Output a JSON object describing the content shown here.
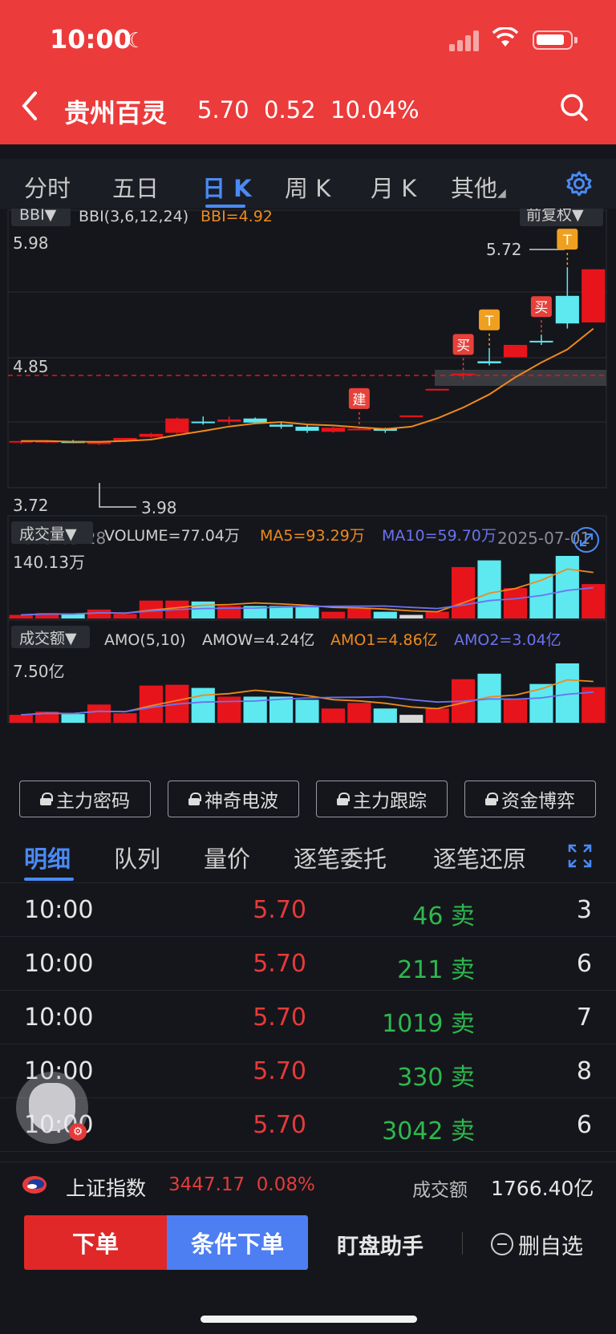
{
  "status": {
    "time": "10:00"
  },
  "header": {
    "name": "贵州百灵",
    "price": "5.70",
    "change": "0.52",
    "pct": "10.04%"
  },
  "ktabs": [
    "分时",
    "五日",
    "日 K",
    "周 K",
    "月 K",
    "其他"
  ],
  "chart": {
    "indicator_btn": "BBI▼",
    "indicator_label": "BBI(3,6,12,24)",
    "indicator_value": "BBI=4.92",
    "adjust_btn": "前复权▼",
    "y_top": "5.98",
    "y_mid": "4.85",
    "y_bottom": "3.72",
    "low_mark": "3.98",
    "high_mark": "5.72",
    "date_start": "2025-05-28",
    "date_end": "2025-07-01",
    "signals": [
      "建",
      "买",
      "T",
      "买",
      "T"
    ],
    "vol_btn": "成交量▼",
    "vol_label": "VOLUME=77.04万",
    "vol_ma5": "MA5=93.29万",
    "vol_ma10": "MA10=59.70万",
    "vol_max": "140.13万",
    "amt_btn": "成交额▼",
    "amt_label": "AMO(5,10)",
    "amt_amow": "AMOW=4.24亿",
    "amt_amo1": "AMO1=4.86亿",
    "amt_amo2": "AMO2=3.04亿",
    "amt_max": "7.50亿",
    "colors": {
      "up": "#e8141c",
      "down": "#5ee8f0",
      "ma_orange": "#ee8a1c",
      "ma_blue": "#6b72f0"
    }
  },
  "chart_data": {
    "type": "candlestick",
    "dates": [
      "2025-05-28",
      "2025-07-01"
    ],
    "ylim": [
      3.72,
      5.98
    ],
    "candles": [
      {
        "o": 4.01,
        "h": 4.02,
        "l": 3.99,
        "c": 4.02
      },
      {
        "o": 4.01,
        "h": 4.03,
        "l": 4.0,
        "c": 4.02
      },
      {
        "o": 4.02,
        "h": 4.03,
        "l": 4.0,
        "c": 4.0
      },
      {
        "o": 3.99,
        "h": 4.02,
        "l": 3.98,
        "c": 4.01
      },
      {
        "o": 4.02,
        "h": 4.05,
        "l": 4.01,
        "c": 4.05
      },
      {
        "o": 4.06,
        "h": 4.1,
        "l": 4.05,
        "c": 4.09
      },
      {
        "o": 4.1,
        "h": 4.25,
        "l": 4.09,
        "c": 4.24
      },
      {
        "o": 4.21,
        "h": 4.26,
        "l": 4.18,
        "c": 4.2
      },
      {
        "o": 4.21,
        "h": 4.26,
        "l": 4.18,
        "c": 4.23
      },
      {
        "o": 4.24,
        "h": 4.25,
        "l": 4.19,
        "c": 4.2
      },
      {
        "o": 4.18,
        "h": 4.2,
        "l": 4.14,
        "c": 4.16
      },
      {
        "o": 4.16,
        "h": 4.18,
        "l": 4.1,
        "c": 4.12
      },
      {
        "o": 4.11,
        "h": 4.16,
        "l": 4.1,
        "c": 4.15
      },
      {
        "o": 4.14,
        "h": 4.16,
        "l": 4.13,
        "c": 4.14
      },
      {
        "o": 4.14,
        "h": 4.15,
        "l": 4.1,
        "c": 4.12
      },
      {
        "o": 4.26,
        "h": 4.27,
        "l": 4.26,
        "c": 4.27
      },
      {
        "o": 4.52,
        "h": 4.53,
        "l": 4.52,
        "c": 4.53
      },
      {
        "o": 4.67,
        "h": 4.69,
        "l": 4.62,
        "c": 4.68
      },
      {
        "o": 4.8,
        "h": 4.93,
        "l": 4.76,
        "c": 4.78
      },
      {
        "o": 4.84,
        "h": 4.96,
        "l": 4.84,
        "c": 4.96
      },
      {
        "o": 5.0,
        "h": 5.06,
        "l": 4.96,
        "c": 4.99
      },
      {
        "o": 5.44,
        "h": 5.72,
        "l": 5.12,
        "c": 5.17
      },
      {
        "o": 5.18,
        "h": 5.7,
        "l": 5.18,
        "c": 5.7
      }
    ],
    "volume": [
      8,
      12,
      10,
      20,
      10,
      40,
      40,
      38,
      28,
      28,
      28,
      25,
      15,
      22,
      15,
      8,
      15,
      115,
      130,
      68,
      100,
      140,
      77
    ],
    "amount": [
      1.0,
      1.4,
      1.1,
      2.3,
      1.2,
      4.7,
      4.8,
      4.4,
      3.3,
      3.3,
      3.3,
      2.9,
      1.8,
      2.5,
      1.8,
      1.0,
      1.8,
      5.5,
      6.2,
      3.0,
      4.9,
      7.5,
      4.5
    ]
  },
  "locks": [
    "主力密码",
    "神奇电波",
    "主力跟踪",
    "资金博弈"
  ],
  "dtabs": [
    "明细",
    "队列",
    "量价",
    "逐笔委托",
    "逐笔还原"
  ],
  "trades": [
    {
      "time": "10:00",
      "price": "5.70",
      "vol": "46 卖",
      "n": "3"
    },
    {
      "time": "10:00",
      "price": "5.70",
      "vol": "211 卖",
      "n": "6"
    },
    {
      "time": "10:00",
      "price": "5.70",
      "vol": "1019 卖",
      "n": "7"
    },
    {
      "time": "10:00",
      "price": "5.70",
      "vol": "330 卖",
      "n": "8"
    },
    {
      "time": "10:00",
      "price": "5.70",
      "vol": "3042 卖",
      "n": "6"
    }
  ],
  "index": {
    "name": "上证指数",
    "value": "3447.17",
    "pct": "0.08%",
    "amt_label": "成交额",
    "amt": "1766.40亿"
  },
  "bottom": {
    "order": "下单",
    "cond_order": "条件下单",
    "watch": "盯盘助手",
    "remove": "删自选"
  }
}
